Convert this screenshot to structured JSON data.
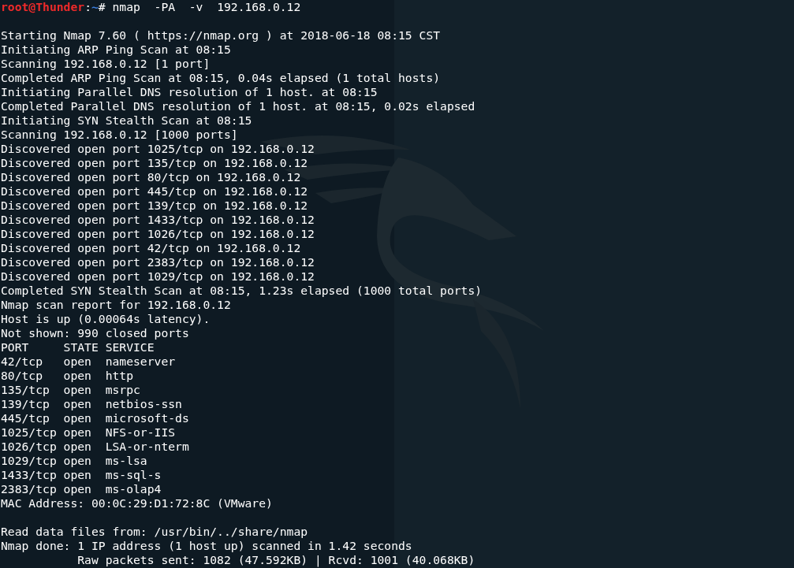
{
  "prompt": {
    "user_host": "root@Thunder",
    "separator": ":",
    "path": "~",
    "symbol": "#",
    "command": "nmap  -PA  -v  192.168.0.12"
  },
  "output": [
    {
      "lines": [
        "Starting Nmap 7.60 ( https://nmap.org ) at 2018-06-18 08:15 CST",
        "Initiating ARP Ping Scan at 08:15",
        "Scanning 192.168.0.12 [1 port]",
        "Completed ARP Ping Scan at 08:15, 0.04s elapsed (1 total hosts)",
        "Initiating Parallel DNS resolution of 1 host. at 08:15",
        "Completed Parallel DNS resolution of 1 host. at 08:15, 0.02s elapsed",
        "Initiating SYN Stealth Scan at 08:15",
        "Scanning 192.168.0.12 [1000 ports]",
        "Discovered open port 1025/tcp on 192.168.0.12",
        "Discovered open port 135/tcp on 192.168.0.12",
        "Discovered open port 80/tcp on 192.168.0.12",
        "Discovered open port 445/tcp on 192.168.0.12",
        "Discovered open port 139/tcp on 192.168.0.12",
        "Discovered open port 1433/tcp on 192.168.0.12",
        "Discovered open port 1026/tcp on 192.168.0.12",
        "Discovered open port 42/tcp on 192.168.0.12",
        "Discovered open port 2383/tcp on 192.168.0.12",
        "Discovered open port 1029/tcp on 192.168.0.12",
        "Completed SYN Stealth Scan at 08:15, 1.23s elapsed (1000 total ports)",
        "Nmap scan report for 192.168.0.12",
        "Host is up (0.00064s latency).",
        "Not shown: 990 closed ports",
        "PORT     STATE SERVICE",
        "42/tcp   open  nameserver",
        "80/tcp   open  http",
        "135/tcp  open  msrpc",
        "139/tcp  open  netbios-ssn",
        "445/tcp  open  microsoft-ds",
        "1025/tcp open  NFS-or-IIS",
        "1026/tcp open  LSA-or-nterm",
        "1029/tcp open  ms-lsa",
        "1433/tcp open  ms-sql-s",
        "2383/tcp open  ms-olap4",
        "MAC Address: 00:0C:29:D1:72:8C (VMware)"
      ]
    },
    {
      "lines": [
        "Read data files from: /usr/bin/../share/nmap",
        "Nmap done: 1 IP address (1 host up) scanned in 1.42 seconds",
        "           Raw packets sent: 1082 (47.592KB) | Rcvd: 1001 (40.068KB)"
      ]
    }
  ]
}
